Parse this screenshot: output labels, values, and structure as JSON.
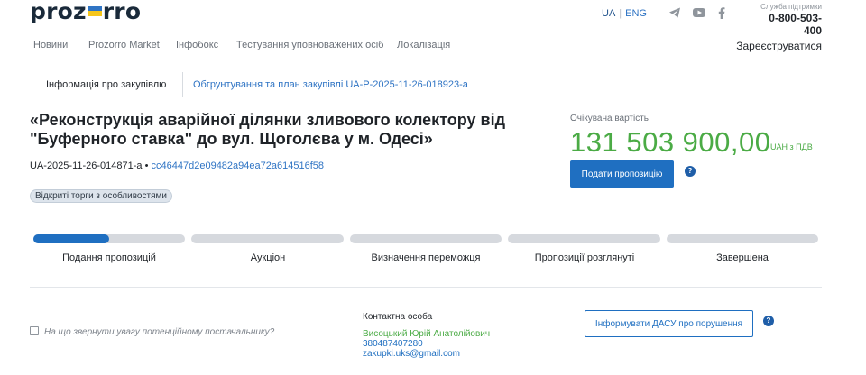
{
  "header": {
    "logo_left": "proz",
    "logo_right": "rro",
    "lang_ua": "UA",
    "lang_sep": "|",
    "lang_eng": "ENG",
    "support_label": "Служба підтримки",
    "support_phone": "0-800-503-400",
    "nav": [
      {
        "label": "Новини"
      },
      {
        "label": "Prozorro Market"
      },
      {
        "label": "Інфобокс"
      },
      {
        "label": "Тестування уповноважених осіб"
      },
      {
        "label": "Локалізація"
      }
    ],
    "register": "Зареєструватися"
  },
  "tabs": {
    "info": "Інформація про закупівлю",
    "plan_link": "Обгрунтування та план закупівлі UA-P-2025-11-26-018923-a"
  },
  "tender": {
    "title": "«Реконструкція аварійної ділянки зливового колектору від \"Буферного ставка\" до вул. Щоголєва у м. Одесі»",
    "id": "UA-2025-11-26-014871-a",
    "bullet": " • ",
    "hash": "cc46447d2e09482a94ea72a614516f58",
    "badge": "Відкриті торги з особливостями",
    "expected_label": "Очікувана вартість",
    "amount": "131 503 900,00",
    "currency": "UAH з ПДВ",
    "submit_button": "Подати пропозицію"
  },
  "progress": {
    "current_stage_fill": 0.5,
    "stages": [
      {
        "label": "Подання пропозицій"
      },
      {
        "label": "Аукціон"
      },
      {
        "label": "Визначення переможця"
      },
      {
        "label": "Пропозиції розглянуті"
      },
      {
        "label": "Завершена"
      }
    ]
  },
  "footer": {
    "hint": "На що звернути увагу потенційному постачальнику?",
    "contact_label": "Контактна особа",
    "contact_name": "Висоцький Юрій Анатолійович",
    "contact_phone": "380487407280",
    "contact_email": "zakupki.uks@gmail.com",
    "dasu_button": "Інформувати ДАСУ про порушення"
  },
  "icons": {
    "help": "?",
    "social": [
      "telegram-icon",
      "youtube-icon",
      "facebook-icon"
    ]
  },
  "colors": {
    "accent": "#1f6fc1",
    "amount": "#4bab45",
    "flag_blue": "#2f74c4",
    "flag_yellow": "#f6c61b"
  }
}
